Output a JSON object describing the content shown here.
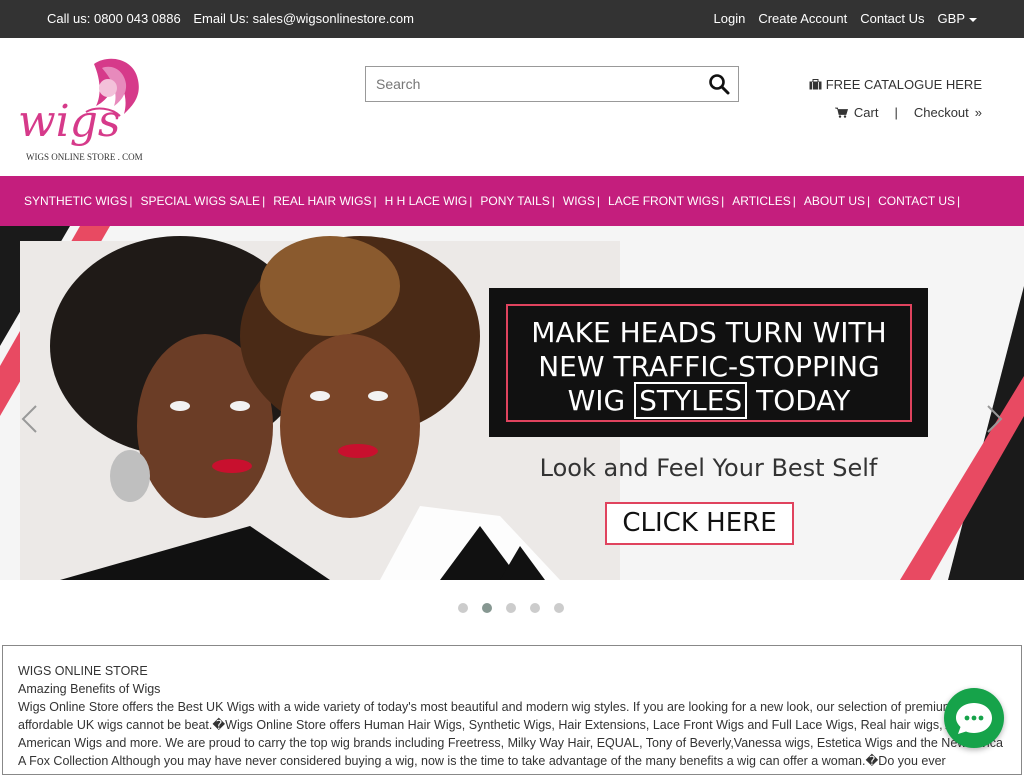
{
  "topbar": {
    "phone": "Call us: 0800 043 0886",
    "email": "Email Us: sales@wigsonlinestore.com",
    "links": [
      "Login",
      "Create Account",
      "Contact Us"
    ],
    "currency": "GBP"
  },
  "header": {
    "logo_text": "wigs",
    "logo_subtext": "WIGS ONLINE STORE . COM",
    "search_placeholder": "Search",
    "catalogue": "FREE CATALOGUE HERE",
    "cart": "Cart",
    "checkout": "Checkout",
    "separator": "|"
  },
  "nav": {
    "items": [
      "SYNTHETIC WIGS",
      "SPECIAL WIGS SALE",
      "REAL HAIR WIGS",
      "H H LACE WIG",
      "PONY TAILS",
      "WIGS",
      "LACE FRONT WIGS",
      "ARTICLES",
      "ABOUT US",
      "CONTACT US"
    ],
    "separator": "|"
  },
  "hero": {
    "line1": "MAKE HEADS TURN WITH",
    "line2": "NEW TRAFFIC-STOPPING",
    "line3_pre": "WIG",
    "line3_box": "STYLES",
    "line3_post": "TODAY",
    "tagline": "Look and Feel Your Best Self",
    "cta": "CLICK HERE",
    "slide_count": 5,
    "active_slide": 2
  },
  "content": {
    "heading": "WIGS ONLINE STORE",
    "subheading": "Amazing Benefits of Wigs",
    "body": "Wigs Online Store offers the Best UK Wigs with a wide variety of today's most beautiful and modern wig styles. If you are looking for a new look, our selection of premium affordable UK wigs cannot be beat.�Wigs Online Store offers Human Hair Wigs, Synthetic Wigs, Hair Extensions, Lace Front Wigs and Full Lace Wigs, Real hair wigs, African American Wigs and more. We are proud to carry the top wig brands including Freetress, Milky Way Hair, EQUAL, Tony of Beverly,Vanessa wigs, Estetica Wigs and the New Vivica A Fox Collection Although you may have never considered buying a wig, now is the time to take advantage of the many benefits a wig can offer a woman.�Do you ever"
  },
  "colors": {
    "topbar": "#333333",
    "nav": "#c41e7d",
    "accent": "#e0435e",
    "chat": "#16a34a"
  }
}
